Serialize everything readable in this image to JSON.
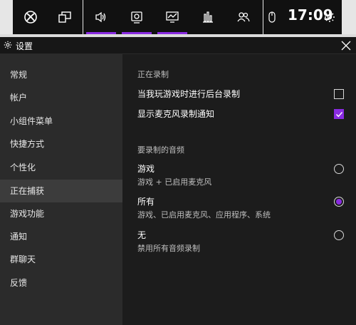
{
  "gamebar": {
    "time": "17:09",
    "accent": "#8a2be2",
    "buttons": [
      {
        "icon": "xbox-icon"
      },
      {
        "icon": "screen-broadcast-icon"
      },
      {
        "icon": "audio-icon"
      },
      {
        "icon": "capture-icon"
      },
      {
        "icon": "performance-icon"
      },
      {
        "icon": "chart-icon"
      },
      {
        "icon": "social-icon"
      },
      {
        "icon": "mouse-icon"
      },
      {
        "icon": "settings-icon"
      }
    ]
  },
  "settings": {
    "title": "设置",
    "nav": [
      "常规",
      "帐户",
      "小组件菜单",
      "快捷方式",
      "个性化",
      "正在捕获",
      "游戏功能",
      "通知",
      "群聊天",
      "反馈"
    ],
    "selected_nav": "正在捕获",
    "recording": {
      "heading": "正在录制",
      "bg_record_label": "当我玩游戏时进行后台录制",
      "bg_record_checked": false,
      "mic_notice_label": "显示麦克风录制通知",
      "mic_notice_checked": true
    },
    "audio": {
      "heading": "要录制的音频",
      "options": [
        {
          "label": "游戏",
          "desc": "游戏 + 已启用麦克风",
          "selected": false
        },
        {
          "label": "所有",
          "desc": "游戏、已启用麦克风、应用程序、系统",
          "selected": true
        },
        {
          "label": "无",
          "desc": "禁用所有音频录制",
          "selected": false
        }
      ]
    }
  }
}
